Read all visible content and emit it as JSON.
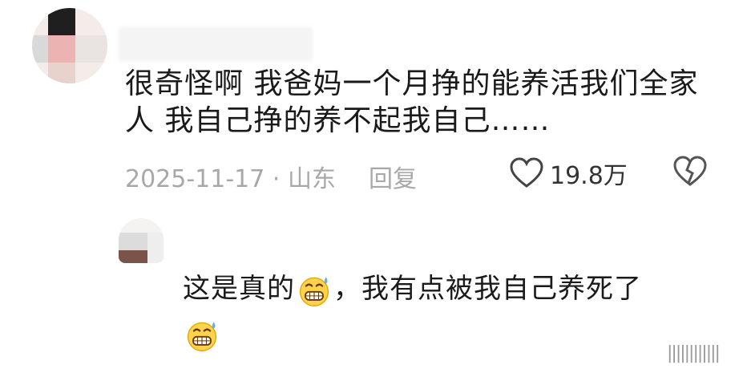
{
  "comment1": {
    "username": "",
    "text": "很奇怪啊 我爸妈一个月挣的能养活我们全家人 我自己挣的养不起我自己……",
    "date": "2025-11-17",
    "location": "山东",
    "reply_label": "回复",
    "like_count": "19.8万"
  },
  "comment2": {
    "text_part1": "这是真的",
    "text_part2": "，我有点被我自己养死了",
    "emoji_name": "grimacing-sweat-emoji"
  },
  "watermark": {
    "label": "||||||||||||"
  },
  "colors": {
    "text": "#1a1a1a",
    "meta": "#a8a8a8",
    "like": "#333333"
  }
}
